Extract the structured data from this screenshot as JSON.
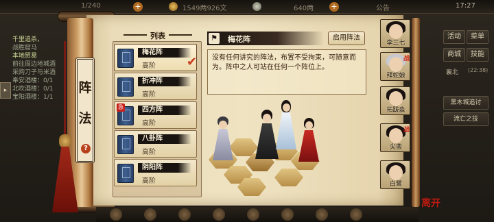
{
  "topbar": {
    "stamina": "1/240",
    "money": "1549两926文",
    "silver": "640两",
    "announce": "公告",
    "time": "17:27"
  },
  "left_panel": {
    "quests": [
      "千里追杀，",
      "战胜窟马",
      "本地贸易",
      "前往周边地城酒",
      "采购刀子与米酒",
      "奉安酒楼：0/1",
      "北吹酒楼：0/1",
      "宝阳酒楼：1/1"
    ]
  },
  "right_menu": {
    "row1": [
      "活动",
      "菜单"
    ],
    "row2": [
      "商城",
      "技能"
    ],
    "loc": "襄北",
    "loc_time": "(22:38)",
    "tasks": [
      "黑木城追讨",
      "流亡之技"
    ]
  },
  "scroll": {
    "title_chars": [
      "阵",
      "法"
    ],
    "help": "?"
  },
  "list": {
    "header": "列表",
    "items": [
      {
        "name": "梅花阵",
        "rank": "高阶",
        "selected": true
      },
      {
        "name": "折冲阵",
        "rank": "高阶",
        "selected": false
      },
      {
        "name": "四方阵",
        "rank": "高阶",
        "selected": false,
        "badge": "急"
      },
      {
        "name": "八卦阵",
        "rank": "高阶",
        "selected": false
      },
      {
        "name": "阴阳阵",
        "rank": "高阶",
        "selected": false
      }
    ],
    "check": "✔"
  },
  "detail": {
    "name": "梅花阵",
    "apply": "启用阵法",
    "desc": "没有任何讲究的阵法，布置不受拘束，可随意而为。阵中之人可站在任何一个阵位上。"
  },
  "portraits": [
    {
      "name": "李三七",
      "hair": "#1a1210",
      "robe": "#3a3a3a"
    },
    {
      "name": "拜蛇娘",
      "hair": "#2a1818",
      "robe": "#d8d8e0",
      "zhan": true
    },
    {
      "name": "拓跋淼",
      "hair": "#1a1210",
      "robe": "#303030"
    },
    {
      "name": "尖蛮",
      "hair": "#1a1210",
      "robe": "#a02020",
      "zhan": true
    },
    {
      "name": "白鹭",
      "hair": "#1a1210",
      "robe": "#e0e0e0"
    }
  ],
  "exit": "离开",
  "colors": {
    "accent": "#c83a18",
    "paper": "#efe3c2",
    "ink": "#2a1a0c"
  }
}
